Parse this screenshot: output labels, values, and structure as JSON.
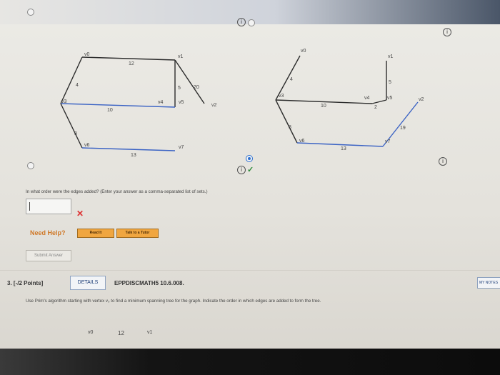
{
  "graph_left": {
    "vertex_labels": [
      "v0",
      "v1",
      "v2",
      "v3",
      "v4",
      "v5",
      "v6",
      "v7"
    ],
    "edge_weights": [
      "12",
      "4",
      "5",
      "20",
      "10",
      "8",
      "13"
    ]
  },
  "graph_right": {
    "vertex_labels": [
      "v0",
      "v1",
      "v2",
      "v3",
      "v4",
      "v5",
      "v6",
      "v7"
    ],
    "edge_weights": [
      "4",
      "5",
      "10",
      "2",
      "19",
      "8",
      "13"
    ]
  },
  "question": {
    "prompt": "In what order were the edges added? (Enter your answer as a comma-separated list of sets.)",
    "answer_value": "",
    "need_help": "Need Help?",
    "read_it": "Read It",
    "talk_to_tutor": "Talk to a Tutor",
    "submit": "Submit Answer"
  },
  "next_question": {
    "number": "3.",
    "points": "[-/2 Points]",
    "details": "DETAILS",
    "code": "EPPDISCMATH5 10.6.008.",
    "my_notes": "MY NOTES",
    "text": "Use Prim's algorithm starting with vertex v₀ to find a minimum spanning tree for the graph. Indicate the order in which edges are added to form the tree.",
    "preview_labels": [
      "v0",
      "12",
      "v1"
    ]
  },
  "colors": {
    "edge_dark": "#2d2d2d",
    "edge_blue": "#3b63c4",
    "highlight": "#f0a640",
    "page_bg": "#e9e7e2"
  }
}
